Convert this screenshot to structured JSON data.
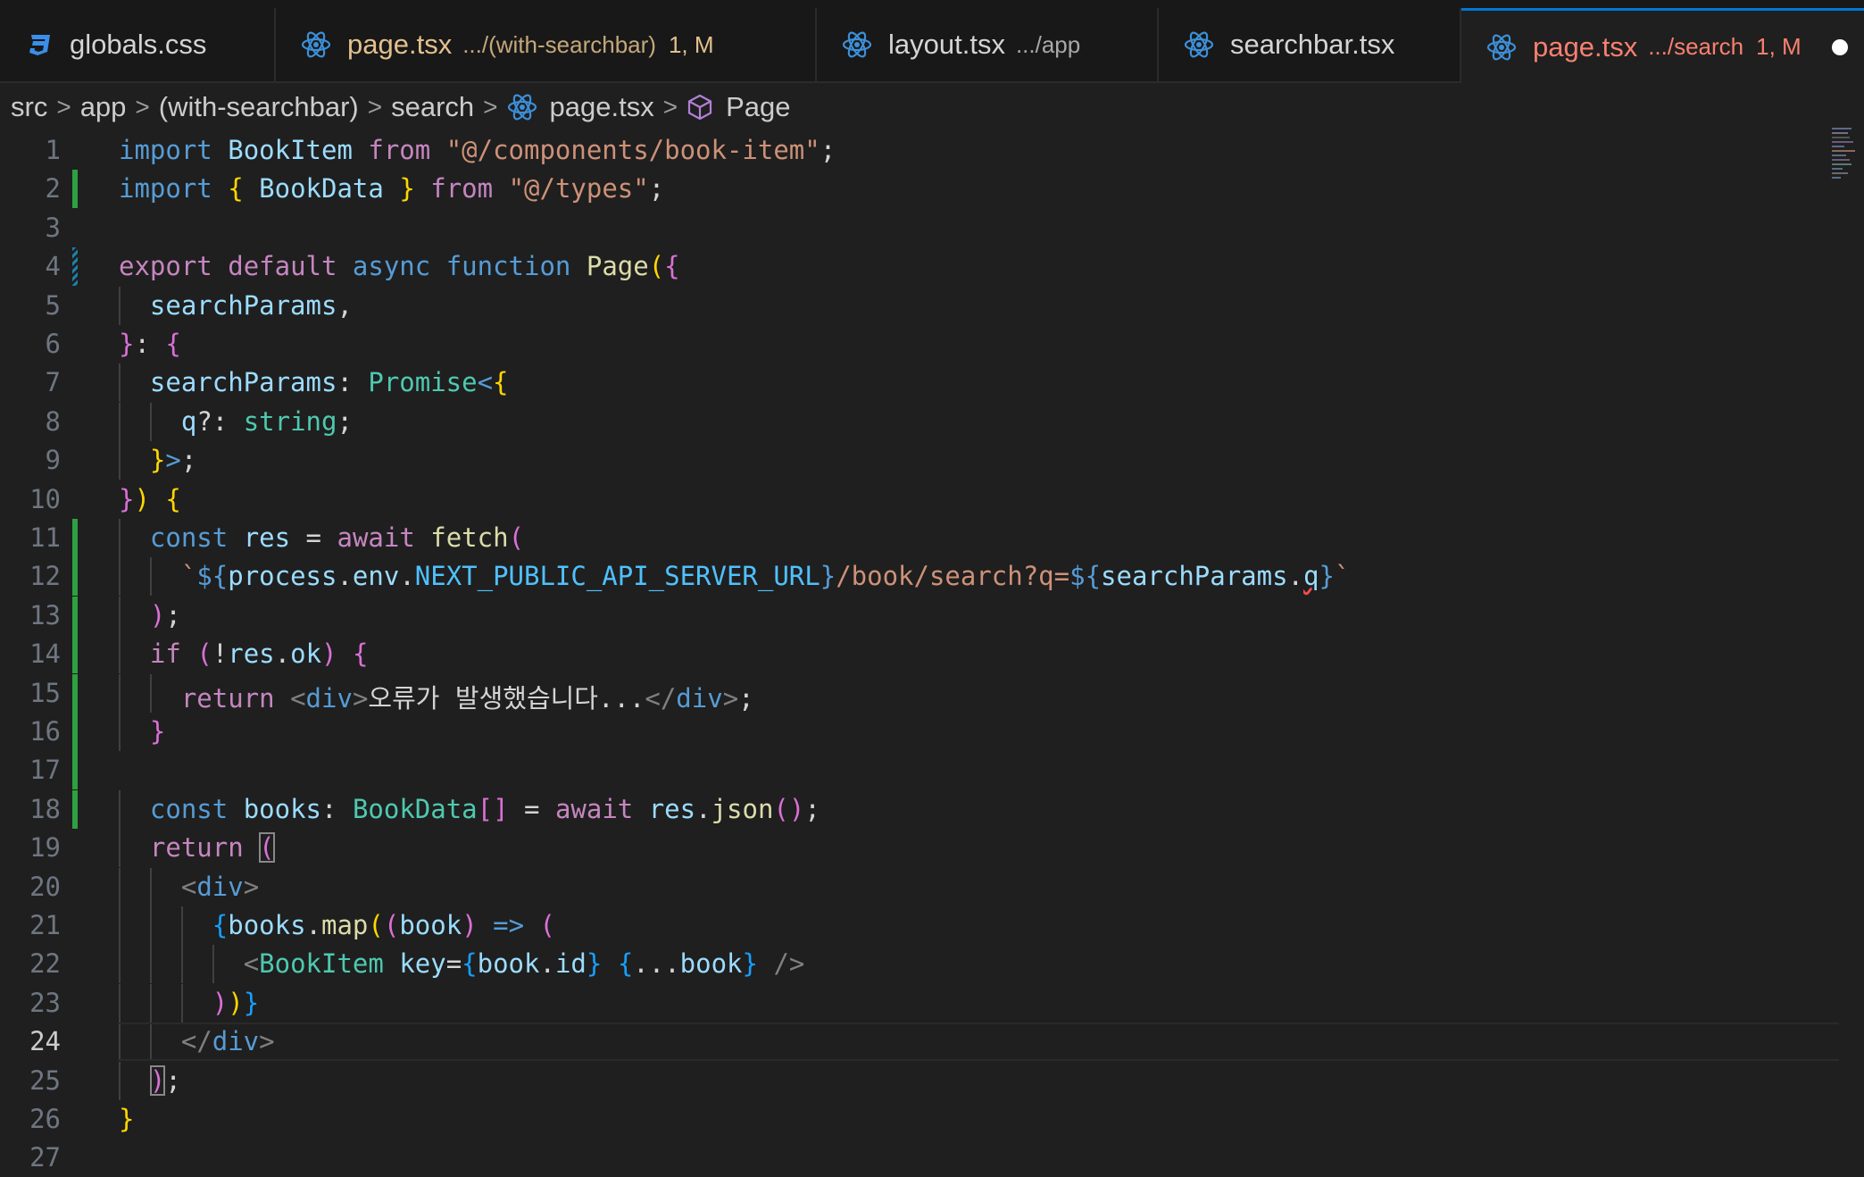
{
  "tabs": [
    {
      "name": "globals.css",
      "desc": "",
      "status": "",
      "icon": "css-icon",
      "state": "normal"
    },
    {
      "name": "page.tsx",
      "desc": ".../(with-searchbar)",
      "status": "1, M",
      "icon": "react-icon",
      "state": "mod"
    },
    {
      "name": "layout.tsx",
      "desc": ".../app",
      "status": "",
      "icon": "react-icon",
      "state": "normal"
    },
    {
      "name": "searchbar.tsx",
      "desc": "",
      "status": "",
      "icon": "react-icon",
      "state": "normal"
    },
    {
      "name": "page.tsx",
      "desc": ".../search",
      "status": "1, M",
      "icon": "react-icon",
      "state": "err-active"
    }
  ],
  "breadcrumb": [
    "src",
    "app",
    "(with-searchbar)",
    "search",
    "page.tsx",
    "Page"
  ],
  "editor": {
    "current_line": 24,
    "line_numbers": [
      "1",
      "2",
      "3",
      "4",
      "5",
      "6",
      "7",
      "8",
      "9",
      "10",
      "11",
      "12",
      "13",
      "14",
      "15",
      "16",
      "17",
      "18",
      "19",
      "20",
      "21",
      "22",
      "23",
      "24",
      "25",
      "26",
      "27"
    ],
    "lines": [
      [
        [
          "kwb",
          "import"
        ],
        [
          "txt",
          " "
        ],
        [
          "var",
          "BookItem"
        ],
        [
          "txt",
          " "
        ],
        [
          "kw",
          "from"
        ],
        [
          "txt",
          " "
        ],
        [
          "str",
          "\"@/components/book-item\""
        ],
        [
          "txt",
          ";"
        ]
      ],
      [
        [
          "kwb",
          "import"
        ],
        [
          "txt",
          " "
        ],
        [
          "p1",
          "{"
        ],
        [
          "txt",
          " "
        ],
        [
          "var",
          "BookData"
        ],
        [
          "txt",
          " "
        ],
        [
          "p1",
          "}"
        ],
        [
          "txt",
          " "
        ],
        [
          "kw",
          "from"
        ],
        [
          "txt",
          " "
        ],
        [
          "str",
          "\"@/types\""
        ],
        [
          "txt",
          ";"
        ]
      ],
      [],
      [
        [
          "kw",
          "export"
        ],
        [
          "txt",
          " "
        ],
        [
          "kw",
          "default"
        ],
        [
          "txt",
          " "
        ],
        [
          "kwb",
          "async"
        ],
        [
          "txt",
          " "
        ],
        [
          "kwb",
          "function"
        ],
        [
          "txt",
          " "
        ],
        [
          "fn",
          "Page"
        ],
        [
          "p1",
          "("
        ],
        [
          "p2",
          "{"
        ]
      ],
      [
        [
          "txt",
          "  "
        ],
        [
          "var",
          "searchParams"
        ],
        [
          "txt",
          ","
        ]
      ],
      [
        [
          "p2",
          "}"
        ],
        [
          "txt",
          ": "
        ],
        [
          "p2",
          "{"
        ]
      ],
      [
        [
          "txt",
          "  "
        ],
        [
          "var",
          "searchParams"
        ],
        [
          "txt",
          ": "
        ],
        [
          "ty",
          "Promise"
        ],
        [
          "kwb",
          "<"
        ],
        [
          "p1",
          "{"
        ]
      ],
      [
        [
          "txt",
          "    "
        ],
        [
          "var",
          "q"
        ],
        [
          "txt",
          "?: "
        ],
        [
          "ty",
          "string"
        ],
        [
          "txt",
          ";"
        ]
      ],
      [
        [
          "txt",
          "  "
        ],
        [
          "p1",
          "}"
        ],
        [
          "kwb",
          ">"
        ],
        [
          "txt",
          ";"
        ]
      ],
      [
        [
          "p2",
          "}"
        ],
        [
          "p1",
          ")"
        ],
        [
          "txt",
          " "
        ],
        [
          "p1",
          "{"
        ]
      ],
      [
        [
          "txt",
          "  "
        ],
        [
          "kwb",
          "const"
        ],
        [
          "txt",
          " "
        ],
        [
          "var",
          "res"
        ],
        [
          "txt",
          " = "
        ],
        [
          "kw",
          "await"
        ],
        [
          "txt",
          " "
        ],
        [
          "fn",
          "fetch"
        ],
        [
          "p2",
          "("
        ]
      ],
      [
        [
          "txt",
          "    "
        ],
        [
          "str",
          "`"
        ],
        [
          "kwb",
          "${"
        ],
        [
          "var",
          "process"
        ],
        [
          "txt",
          "."
        ],
        [
          "var",
          "env"
        ],
        [
          "txt",
          "."
        ],
        [
          "cst",
          "NEXT_PUBLIC_API_SERVER_URL"
        ],
        [
          "kwb",
          "}"
        ],
        [
          "str",
          "/book/search?q="
        ],
        [
          "kwb",
          "${"
        ],
        [
          "var",
          "searchParams"
        ],
        [
          "txt",
          "."
        ],
        [
          "var squig",
          "q"
        ],
        [
          "kwb",
          "}"
        ],
        [
          "str",
          "`"
        ]
      ],
      [
        [
          "txt",
          "  "
        ],
        [
          "p2",
          ")"
        ],
        [
          "txt",
          ";"
        ]
      ],
      [
        [
          "txt",
          "  "
        ],
        [
          "kw",
          "if"
        ],
        [
          "txt",
          " "
        ],
        [
          "p2",
          "("
        ],
        [
          "txt",
          "!"
        ],
        [
          "var",
          "res"
        ],
        [
          "txt",
          "."
        ],
        [
          "var",
          "ok"
        ],
        [
          "p2",
          ")"
        ],
        [
          "txt",
          " "
        ],
        [
          "p2",
          "{"
        ]
      ],
      [
        [
          "txt",
          "    "
        ],
        [
          "kw",
          "return"
        ],
        [
          "txt",
          " "
        ],
        [
          "pun",
          "<"
        ],
        [
          "tag",
          "div"
        ],
        [
          "pun",
          ">"
        ],
        [
          "txt",
          "오류가 발생했습니다..."
        ],
        [
          "pun",
          "</"
        ],
        [
          "tag",
          "div"
        ],
        [
          "pun",
          ">"
        ],
        [
          "txt",
          ";"
        ]
      ],
      [
        [
          "txt",
          "  "
        ],
        [
          "p2",
          "}"
        ]
      ],
      [],
      [
        [
          "txt",
          "  "
        ],
        [
          "kwb",
          "const"
        ],
        [
          "txt",
          " "
        ],
        [
          "var",
          "books"
        ],
        [
          "txt",
          ": "
        ],
        [
          "ty",
          "BookData"
        ],
        [
          "p2",
          "[]"
        ],
        [
          "txt",
          " = "
        ],
        [
          "kw",
          "await"
        ],
        [
          "txt",
          " "
        ],
        [
          "var",
          "res"
        ],
        [
          "txt",
          "."
        ],
        [
          "fn",
          "json"
        ],
        [
          "p2",
          "()"
        ],
        [
          "txt",
          ";"
        ]
      ],
      [
        [
          "txt",
          "  "
        ],
        [
          "kw",
          "return"
        ],
        [
          "txt",
          " "
        ],
        [
          "p2 boxed",
          "("
        ]
      ],
      [
        [
          "txt",
          "    "
        ],
        [
          "pun",
          "<"
        ],
        [
          "tag",
          "div"
        ],
        [
          "pun",
          ">"
        ]
      ],
      [
        [
          "txt",
          "      "
        ],
        [
          "p3",
          "{"
        ],
        [
          "var",
          "books"
        ],
        [
          "txt",
          "."
        ],
        [
          "fn",
          "map"
        ],
        [
          "p1",
          "("
        ],
        [
          "p2",
          "("
        ],
        [
          "var",
          "book"
        ],
        [
          "p2",
          ")"
        ],
        [
          "txt",
          " "
        ],
        [
          "kwb",
          "=>"
        ],
        [
          "txt",
          " "
        ],
        [
          "p2",
          "("
        ]
      ],
      [
        [
          "txt",
          "        "
        ],
        [
          "pun",
          "<"
        ],
        [
          "ty",
          "BookItem"
        ],
        [
          "txt",
          " "
        ],
        [
          "var",
          "key"
        ],
        [
          "txt",
          "="
        ],
        [
          "p3",
          "{"
        ],
        [
          "var",
          "book"
        ],
        [
          "txt",
          "."
        ],
        [
          "var",
          "id"
        ],
        [
          "p3",
          "}"
        ],
        [
          "txt",
          " "
        ],
        [
          "p3",
          "{"
        ],
        [
          "txt",
          "..."
        ],
        [
          "var",
          "book"
        ],
        [
          "p3",
          "}"
        ],
        [
          "txt",
          " "
        ],
        [
          "pun",
          "/>"
        ]
      ],
      [
        [
          "txt",
          "      "
        ],
        [
          "p2",
          ")"
        ],
        [
          "p1",
          ")"
        ],
        [
          "p3",
          "}"
        ]
      ],
      [
        [
          "txt",
          "    "
        ],
        [
          "pun",
          "</"
        ],
        [
          "tag",
          "div"
        ],
        [
          "pun",
          ">"
        ]
      ],
      [
        [
          "txt",
          "  "
        ],
        [
          "p2 boxed",
          ")"
        ],
        [
          "txt",
          ";"
        ]
      ],
      [
        [
          "p1",
          "}"
        ]
      ],
      []
    ],
    "gutter": {
      "2": "add",
      "4": "mod",
      "11": "add",
      "12": "add",
      "13": "add",
      "14": "add",
      "15": "add",
      "16": "add",
      "17": "add",
      "18": "add"
    }
  },
  "colors": {
    "background": "#1f1f1f",
    "tab_active_border": "#0078d4",
    "modified": "#e2c08d",
    "error": "#f88070",
    "added_gutter": "#2ea043"
  }
}
